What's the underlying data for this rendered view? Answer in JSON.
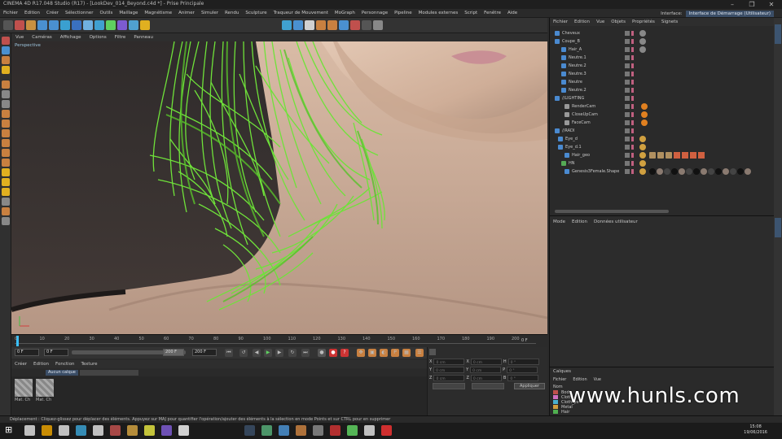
{
  "window": {
    "title": "CINEMA 4D R17.048 Studio (R17) - [LookDev_014_Beyond.c4d *] - Prise Principale"
  },
  "menubar": {
    "items": [
      "Fichier",
      "Edition",
      "Créer",
      "Sélectionner",
      "Outils",
      "Maillage",
      "Magnétisme",
      "Animer",
      "Simuler",
      "Rendu",
      "Sculpture",
      "Traqueur de Mouvement",
      "MoGraph",
      "Personnage",
      "Pipeline",
      "Modules externes",
      "Script",
      "Fenêtre",
      "Aide"
    ],
    "interface_label": "Interface:",
    "interface_value": "Interface de Démarrage (Utilisateur)"
  },
  "viewport": {
    "menu": [
      "Vue",
      "Caméras",
      "Affichage",
      "Options",
      "Filtre",
      "Panneau"
    ],
    "label": "Perspective"
  },
  "timeline": {
    "ticks": [
      "0",
      "10",
      "20",
      "30",
      "40",
      "50",
      "60",
      "70",
      "80",
      "90",
      "100",
      "110",
      "120",
      "130",
      "140",
      "150",
      "160",
      "170",
      "180",
      "190",
      "200"
    ],
    "end_label": "0 F"
  },
  "transport": {
    "current": "0 F",
    "start": "0 F",
    "end": "200 F",
    "end2": "200 F"
  },
  "materials": {
    "menu": [
      "Créer",
      "Edition",
      "Fonction",
      "Texture"
    ],
    "filter": "Aucun calque",
    "items": [
      "Mat. Ch",
      "Mat. Ch"
    ]
  },
  "coords": {
    "rows": [
      {
        "a": "X",
        "av": "0 cm",
        "b": "X",
        "bv": "0 cm",
        "c": "H",
        "cv": "0 °"
      },
      {
        "a": "Y",
        "av": "0 cm",
        "b": "Y",
        "bv": "0 cm",
        "c": "P",
        "cv": "0 °"
      },
      {
        "a": "Z",
        "av": "0 cm",
        "b": "Z",
        "bv": "0 cm",
        "c": "B",
        "cv": "0 °"
      }
    ],
    "apply": "Appliquer"
  },
  "objects": {
    "menu": [
      "Fichier",
      "Edition",
      "Vue",
      "Objets",
      "Propriétés",
      "Signets"
    ],
    "rows": [
      {
        "name": "Cheveux",
        "indent": 6,
        "color": "#4a8ad0"
      },
      {
        "name": "Coupe_B",
        "indent": 6,
        "color": "#4a8ad0"
      },
      {
        "name": "Hair_A",
        "indent": 14,
        "color": "#4a8ad0"
      },
      {
        "name": "Neutre.1",
        "indent": 14,
        "color": "#4a8ad0"
      },
      {
        "name": "Neutre.2",
        "indent": 14,
        "color": "#4a8ad0"
      },
      {
        "name": "Neutre.3",
        "indent": 14,
        "color": "#4a8ad0"
      },
      {
        "name": "Neutre",
        "indent": 14,
        "color": "#4a8ad0"
      },
      {
        "name": "Neutre.2",
        "indent": 14,
        "color": "#4a8ad0"
      },
      {
        "name": "//LIGHTING",
        "indent": 6,
        "color": "#4a8ad0"
      },
      {
        "name": "RenderCam",
        "indent": 18,
        "color": "#999"
      },
      {
        "name": "CloseUpCam",
        "indent": 18,
        "color": "#999"
      },
      {
        "name": "FaceCam",
        "indent": 18,
        "color": "#999"
      },
      {
        "name": "//RADI",
        "indent": 6,
        "color": "#4a8ad0"
      },
      {
        "name": "Eye_d",
        "indent": 10,
        "color": "#4a8ad0"
      },
      {
        "name": "Eye_d.1",
        "indent": 10,
        "color": "#4a8ad0"
      },
      {
        "name": "Hair_geo",
        "indent": 18,
        "color": "#4a8ad0"
      },
      {
        "name": "HN",
        "indent": 14,
        "color": "#5a5"
      },
      {
        "name": "Genesis3Female.Shape",
        "indent": 18,
        "color": "#4a8ad0"
      }
    ]
  },
  "attributes": {
    "menu": [
      "Mode",
      "Edition",
      "Données utilisateur"
    ]
  },
  "layers": {
    "title": "Calques",
    "menu": [
      "Fichier",
      "Edition",
      "Vue"
    ],
    "header": "Nom",
    "rows": [
      {
        "name": "Body",
        "color": "#c0504d"
      },
      {
        "name": "Cloth",
        "color": "#d070c0"
      },
      {
        "name": "Cloth_ye",
        "color": "#4ab0d0"
      },
      {
        "name": "Metal",
        "color": "#d0a040"
      },
      {
        "name": "Hair",
        "color": "#50b050"
      }
    ]
  },
  "status": "Déplacement : Cliquez-glissez pour déplacer des éléments. Appuyez sur MAJ pour quantifier l'opération/ajouter des éléments à la sélection en mode Points et sur CTRL pour en supprimer",
  "clock": {
    "time": "15:08",
    "date": "19/06/2016"
  },
  "watermark": "www.hunls.com",
  "colors": {
    "hair": "#6fe23a",
    "skin": "#d7b9a4",
    "accent": "#3a4d66"
  }
}
